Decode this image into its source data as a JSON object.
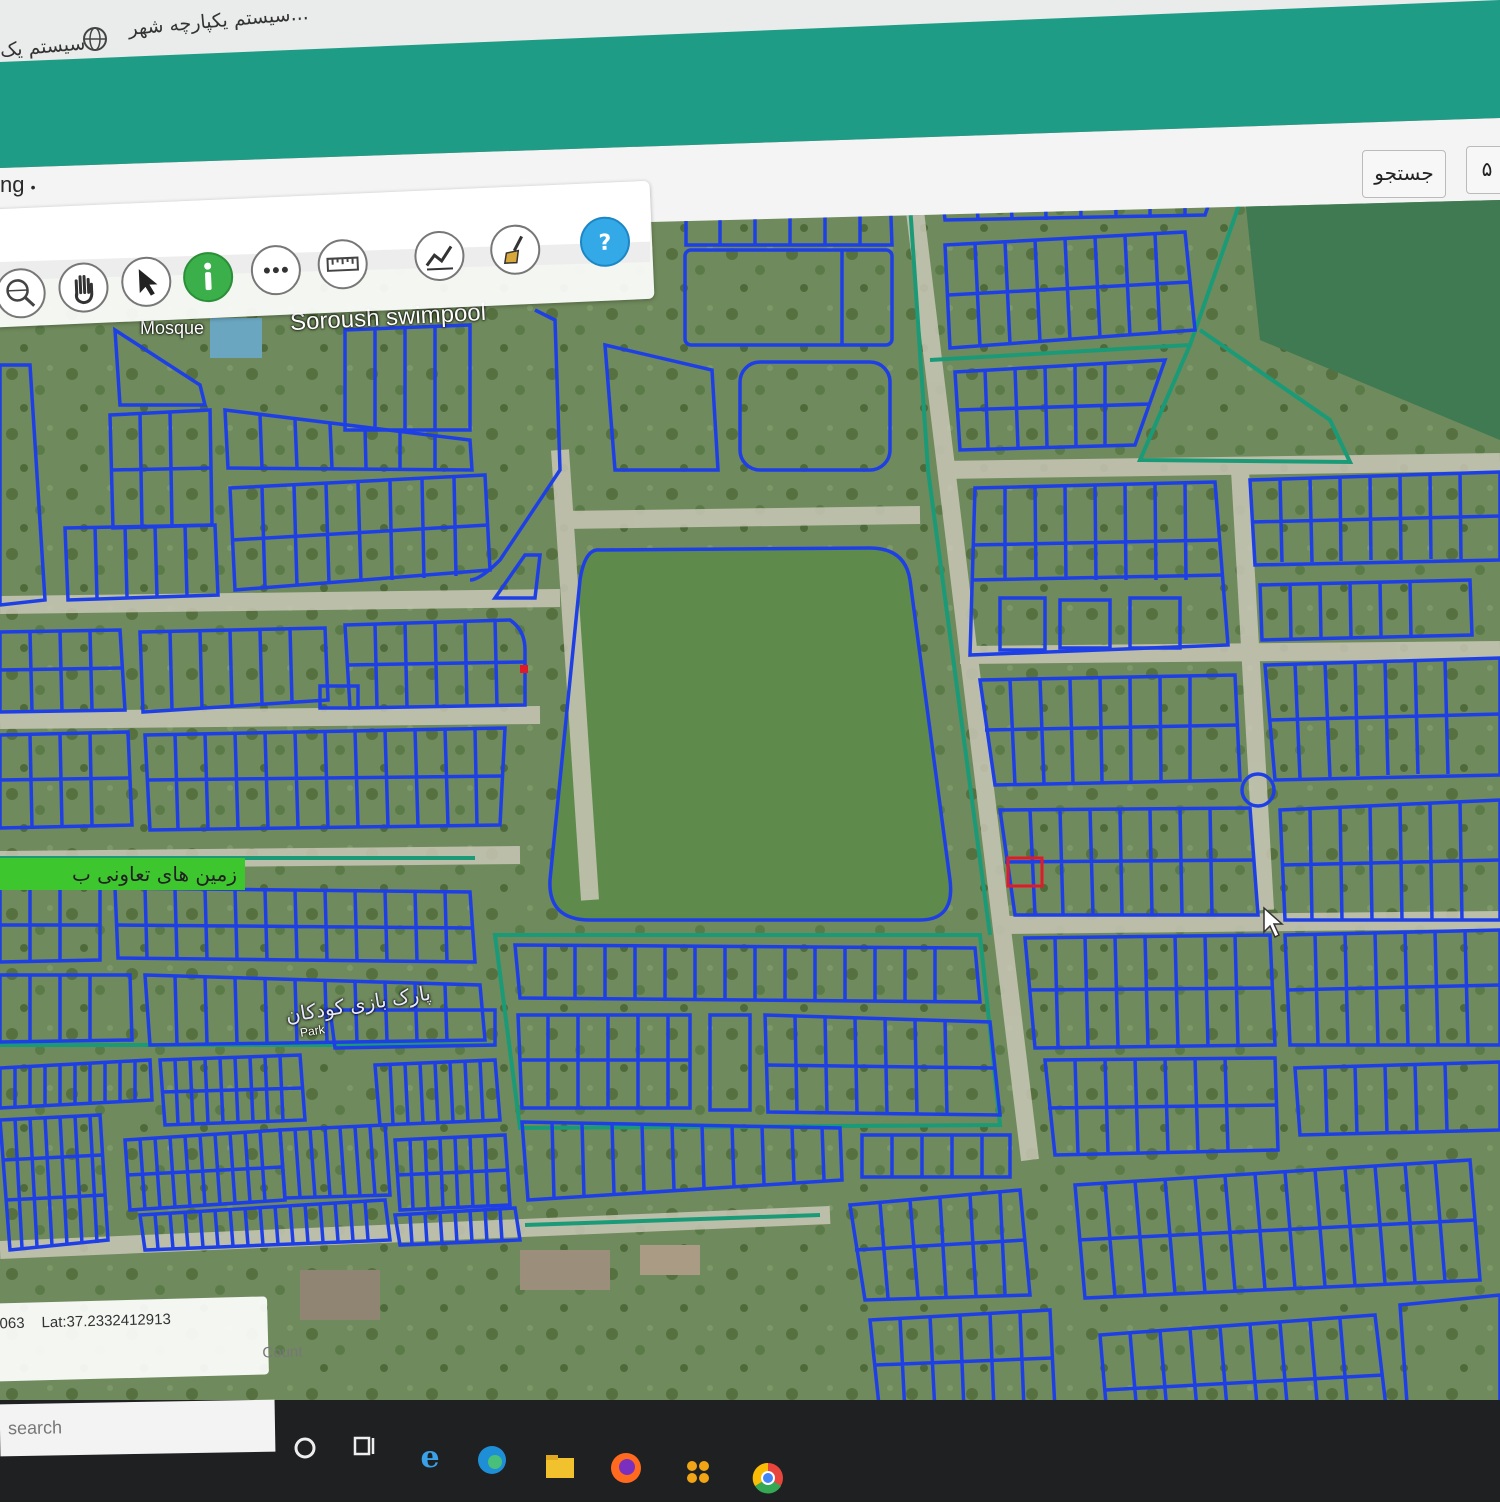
{
  "browser": {
    "tabs": [
      {
        "label": "سیستم یکپارچه شهر..."
      },
      {
        "label": "سیستم یک"
      }
    ]
  },
  "app": {
    "title_fragment": "ng",
    "search_label": "جستجو",
    "page_label": "۵"
  },
  "toolbar": {
    "tools": [
      {
        "name": "zoom-tool"
      },
      {
        "name": "pan-tool"
      },
      {
        "name": "select-tool"
      },
      {
        "name": "info-tool"
      },
      {
        "name": "more-tool"
      },
      {
        "name": "measure-tool"
      },
      {
        "name": "chart-tool"
      },
      {
        "name": "clear-tool"
      },
      {
        "name": "help-tool"
      }
    ]
  },
  "map": {
    "labels": {
      "mosque": "Mosque",
      "pool": "Soroush swimpool",
      "cooperative_lands": "زمین های تعاونی ب",
      "kids_park": "پارک بازی کودکان",
      "park_sub": "Park"
    },
    "colors": {
      "parcel": "#1f3fe6",
      "road_line": "#1b9a78",
      "selected_parcel": "#e11a2a",
      "green_label": "#3ec62f"
    }
  },
  "coordinates": {
    "lon_fragment": "063",
    "lat": "Lat:37.2332412913",
    "count_label": "Count"
  },
  "taskbar": {
    "search_placeholder": "search",
    "apps": [
      "task-view",
      "internet-explorer",
      "edge",
      "file-explorer",
      "firefox",
      "app-launcher",
      "chrome"
    ]
  }
}
